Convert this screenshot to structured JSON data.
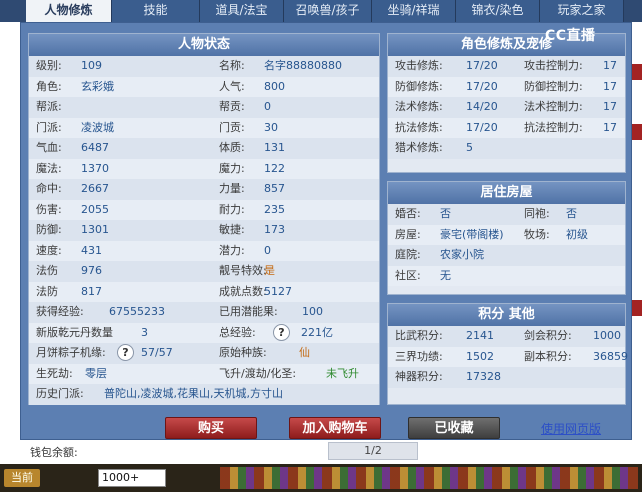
{
  "tabs": [
    "人物修炼",
    "技能",
    "道具/法宝",
    "召唤兽/孩子",
    "坐骑/祥瑞",
    "锦衣/染色",
    "玩家之家"
  ],
  "watermark": "CC直播",
  "status": {
    "title": "人物状态",
    "rows": [
      {
        "l1": "级别:",
        "v1": "109",
        "l2": "名称:",
        "v2": "名字88880880"
      },
      {
        "l1": "角色:",
        "v1": "玄彩娥",
        "l2": "人气:",
        "v2": "800"
      },
      {
        "l1": "帮派:",
        "v1": "",
        "l2": "帮贡:",
        "v2": "0"
      },
      {
        "l1": "门派:",
        "v1": "凌波城",
        "l2": "门贡:",
        "v2": "30"
      },
      {
        "l1": "气血:",
        "v1": "6487",
        "l2": "体质:",
        "v2": "131"
      },
      {
        "l1": "魔法:",
        "v1": "1370",
        "l2": "魔力:",
        "v2": "122"
      },
      {
        "l1": "命中:",
        "v1": "2667",
        "l2": "力量:",
        "v2": "857"
      },
      {
        "l1": "伤害:",
        "v1": "2055",
        "l2": "耐力:",
        "v2": "235"
      },
      {
        "l1": "防御:",
        "v1": "1301",
        "l2": "敏捷:",
        "v2": "173"
      },
      {
        "l1": "速度:",
        "v1": "431",
        "l2": "潜力:",
        "v2": "0"
      },
      {
        "l1": "法伤",
        "v1": "976",
        "l2": "靓号特效:",
        "v2": "是"
      },
      {
        "l1": "法防",
        "v1": "817",
        "l2": "成就点数:",
        "v2": "5127"
      },
      {
        "l1": "获得经验:",
        "v1": "67555233",
        "l2": "已用潜能果:",
        "v2": "100"
      },
      {
        "l1": "新版乾元丹数量",
        "v1": "3",
        "l2": "总经验:",
        "v2": "221亿"
      },
      {
        "l1": "月饼粽子机缘:",
        "v1": "57/57",
        "l2": "原始种族:",
        "v2": "仙"
      },
      {
        "l1": "生死劫:",
        "v1": "零层",
        "l2": "飞升/渡劫/化圣:",
        "v2": "未飞升"
      },
      {
        "l1": "历史门派:",
        "v1": "普陀山,凌波城,花果山,天机城,方寸山",
        "l2": "",
        "v2": ""
      }
    ]
  },
  "cultivation": {
    "title": "角色修炼及宠修",
    "rows": [
      {
        "l1": "攻击修炼:",
        "v1": "17/20",
        "l2": "攻击控制力:",
        "v2": "17"
      },
      {
        "l1": "防御修炼:",
        "v1": "17/20",
        "l2": "防御控制力:",
        "v2": "17"
      },
      {
        "l1": "法术修炼:",
        "v1": "14/20",
        "l2": "法术控制力:",
        "v2": "17"
      },
      {
        "l1": "抗法修炼:",
        "v1": "17/20",
        "l2": "抗法控制力:",
        "v2": "17"
      },
      {
        "l1": "猎术修炼:",
        "v1": "5",
        "l2": "",
        "v2": ""
      }
    ]
  },
  "house": {
    "title": "居住房屋",
    "rows": [
      {
        "l1": "婚否:",
        "v1": "否",
        "l2": "同袍:",
        "v2": "否"
      },
      {
        "l1": "房屋:",
        "v1": "豪宅(带阁楼)",
        "l2": "牧场:",
        "v2": "初级"
      },
      {
        "l1": "庭院:",
        "v1": "农家小院",
        "l2": "",
        "v2": ""
      },
      {
        "l1": "社区:",
        "v1": "无",
        "l2": "",
        "v2": ""
      }
    ]
  },
  "points": {
    "title": "积分 其他",
    "rows": [
      {
        "l1": "比武积分:",
        "v1": "2141",
        "l2": "剑会积分:",
        "v2": "1000"
      },
      {
        "l1": "三界功绩:",
        "v1": "1502",
        "l2": "副本积分:",
        "v2": "36859"
      },
      {
        "l1": "神器积分:",
        "v1": "17328",
        "l2": "",
        "v2": ""
      }
    ]
  },
  "buttons": {
    "buy": "购买",
    "cart": "加入购物车",
    "saved": "已收藏",
    "web": "使用网页版"
  },
  "below": {
    "wallet": "钱包余额:",
    "pager": "1/2"
  },
  "gamebar": {
    "now": "当前",
    "input": "1000+"
  },
  "colors": {
    "panel": "#5c7fb2",
    "header": "#4f72a6",
    "value": "#27558f",
    "buy": "#8e1c1c"
  }
}
